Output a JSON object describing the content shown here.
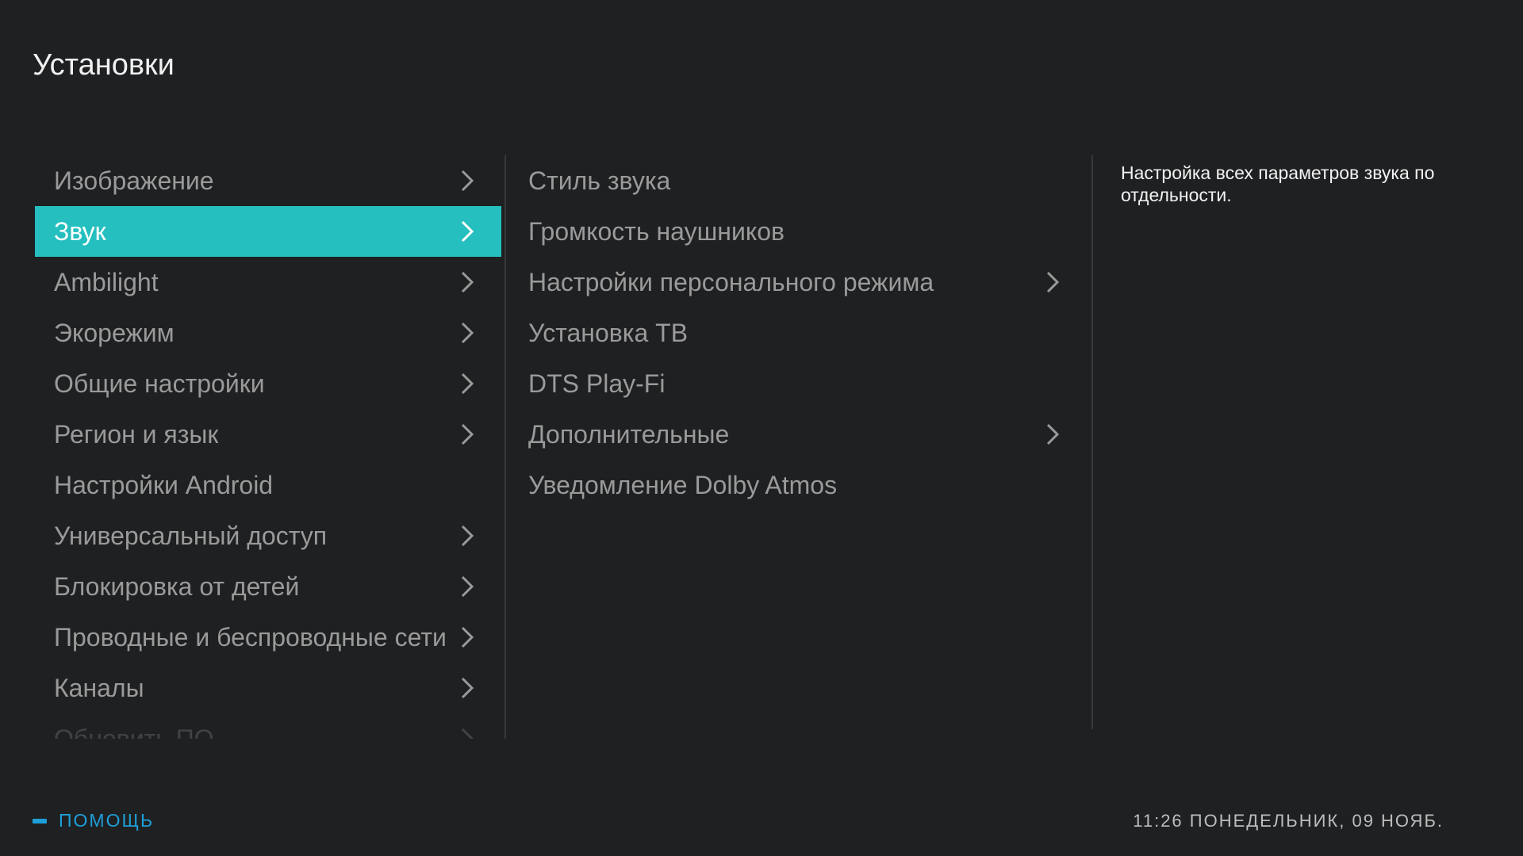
{
  "page": {
    "title": "Установки"
  },
  "categories": [
    {
      "label": "Изображение",
      "has_submenu": true,
      "selected": false
    },
    {
      "label": "Звук",
      "has_submenu": true,
      "selected": true
    },
    {
      "label": "Ambilight",
      "has_submenu": true,
      "selected": false
    },
    {
      "label": "Экорежим",
      "has_submenu": true,
      "selected": false
    },
    {
      "label": "Общие настройки",
      "has_submenu": true,
      "selected": false
    },
    {
      "label": "Регион и язык",
      "has_submenu": true,
      "selected": false
    },
    {
      "label": "Настройки Android",
      "has_submenu": false,
      "selected": false
    },
    {
      "label": "Универсальный доступ",
      "has_submenu": true,
      "selected": false
    },
    {
      "label": "Блокировка от детей",
      "has_submenu": true,
      "selected": false
    },
    {
      "label": "Проводные и беспроводные сети",
      "has_submenu": true,
      "selected": false
    },
    {
      "label": "Каналы",
      "has_submenu": true,
      "selected": false
    },
    {
      "label": "Обновить ПО",
      "has_submenu": true,
      "selected": false
    }
  ],
  "sound_options": [
    {
      "label": "Стиль звука",
      "has_submenu": false
    },
    {
      "label": "Громкость наушников",
      "has_submenu": false
    },
    {
      "label": "Настройки персонального режима",
      "has_submenu": true
    },
    {
      "label": "Установка ТВ",
      "has_submenu": false
    },
    {
      "label": "DTS Play-Fi",
      "has_submenu": false
    },
    {
      "label": "Дополнительные",
      "has_submenu": true
    },
    {
      "label": "Уведомление Dolby Atmos",
      "has_submenu": false
    }
  ],
  "description": "Настройка всех параметров звука по отдельности.",
  "footer": {
    "help_label": "ПОМОЩЬ",
    "clock": "11:26 ПОНЕДЕЛЬНИК, 09 НОЯБ."
  },
  "colors": {
    "background": "#1f2022",
    "selection": "#26bfbf",
    "help_accent": "#1e9fd8"
  }
}
